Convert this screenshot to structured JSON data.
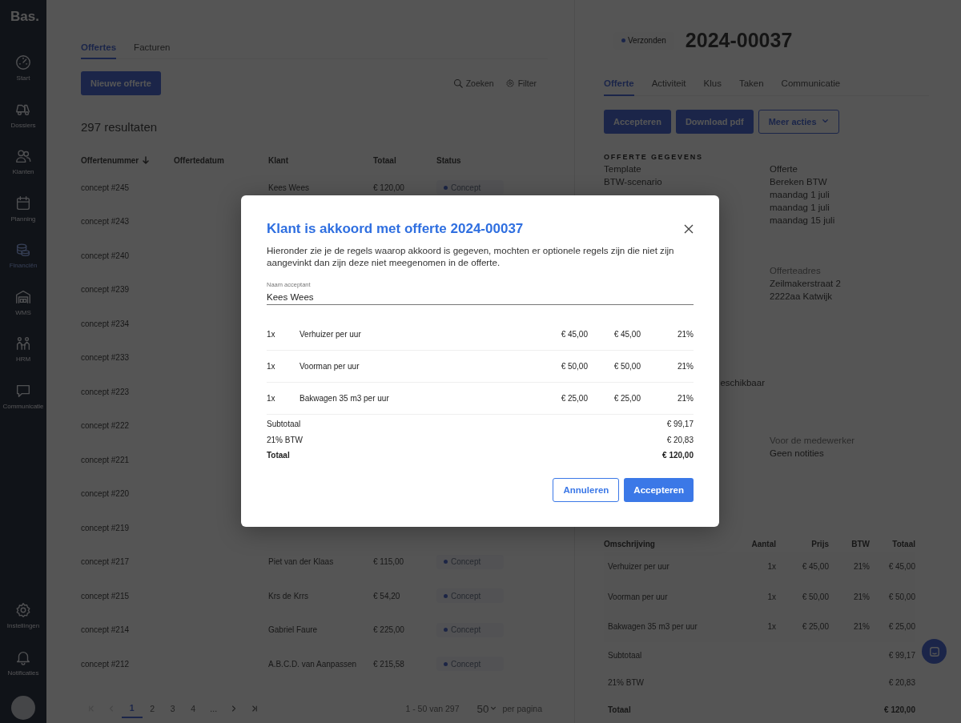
{
  "sidebar": {
    "logo": "Bas.",
    "items": [
      {
        "label": "Start",
        "selected": false
      },
      {
        "label": "Dossiers",
        "selected": false
      },
      {
        "label": "Klanten",
        "selected": false
      },
      {
        "label": "Planning",
        "selected": false
      },
      {
        "label": "Financiën",
        "selected": true
      },
      {
        "label": "WMS",
        "selected": false
      },
      {
        "label": "HRM",
        "selected": false
      },
      {
        "label": "Communicatie",
        "selected": false
      }
    ],
    "bottom_items": [
      {
        "label": "Instellingen"
      },
      {
        "label": "Notificaties"
      }
    ]
  },
  "list_panel": {
    "tabs": [
      {
        "label": "Offertes",
        "selected": true
      },
      {
        "label": "Facturen",
        "selected": false
      }
    ],
    "new_button": "Nieuwe offerte",
    "search": "Zoeken",
    "filter": "Filter",
    "result_count": "297 resultaten",
    "columns": [
      {
        "label": "Offertenummer",
        "sorted": true
      },
      {
        "label": "Offertedatum",
        "sorted": false
      },
      {
        "label": "Klant",
        "sorted": false
      },
      {
        "label": "Totaal",
        "sorted": false
      },
      {
        "label": "Status",
        "sorted": false
      }
    ],
    "rows": [
      {
        "number": "concept #245",
        "client": "Kees Wees",
        "total": "€ 120,00",
        "status": "Concept"
      },
      {
        "number": "concept #243"
      },
      {
        "number": "concept #240"
      },
      {
        "number": "concept #239"
      },
      {
        "number": "concept #234"
      },
      {
        "number": "concept #233"
      },
      {
        "number": "concept #223"
      },
      {
        "number": "concept #222"
      },
      {
        "number": "concept #221"
      },
      {
        "number": "concept #220"
      },
      {
        "number": "concept #219"
      },
      {
        "number": "concept #217",
        "client": "Piet van der Klaas",
        "total": "€ 115,00",
        "status": "Concept"
      },
      {
        "number": "concept #215",
        "client": "Krs de Krrs",
        "total": "€ 54,20",
        "status": "Concept"
      },
      {
        "number": "concept #214",
        "client": "Gabriel Faure",
        "total": "€ 225,00",
        "status": "Concept"
      },
      {
        "number": "concept #212",
        "client": "A.B.C.D. van Aanpassen",
        "total": "€ 215,58",
        "status": "Concept"
      }
    ],
    "pagination": {
      "before": [
        {
          "kind": "first",
          "disabled": true
        },
        {
          "kind": "prev",
          "disabled": true
        }
      ],
      "pages": [
        {
          "label": "1",
          "selected": true
        },
        {
          "label": "2",
          "selected": false
        },
        {
          "label": "3",
          "selected": false
        },
        {
          "label": "4",
          "selected": false
        },
        {
          "label": "...",
          "selected": false
        }
      ],
      "after": [
        {
          "kind": "next",
          "disabled": false
        },
        {
          "kind": "last",
          "disabled": false
        }
      ],
      "range": "1 - 50 van 297",
      "per_page": "50",
      "per_page_label": "per pagina"
    }
  },
  "detail_panel": {
    "status": "Verzonden",
    "number": "2024-00037",
    "tabs": [
      {
        "label": "Offerte",
        "selected": true
      },
      {
        "label": "Activiteit",
        "selected": false
      },
      {
        "label": "Klus",
        "selected": false
      },
      {
        "label": "Taken",
        "selected": false
      },
      {
        "label": "Communicatie",
        "selected": false
      }
    ],
    "actions": [
      {
        "label": "Accepteren",
        "kind": "primary"
      },
      {
        "label": "Download pdf",
        "kind": "primary"
      },
      {
        "label": "Meer acties",
        "kind": "dropdown"
      }
    ],
    "section_title": "OFFERTE GEGEVENS",
    "fields": [
      {
        "label": "Template",
        "value": "Offerte"
      },
      {
        "label": "BTW-scenario",
        "value": "Bereken BTW"
      },
      {
        "value": "maandag 1 juli"
      },
      {
        "value": "maandag 1 juli"
      },
      {
        "value": "maandag 15 juli"
      }
    ],
    "address": {
      "label": "Offerteadres",
      "lines": [
        "Zeilmakerstraat 2",
        "2222aa Katwijk"
      ]
    },
    "partial_text": "eschikbaar",
    "notes": {
      "label": "Voor de medewerker",
      "value": "Geen notities"
    },
    "columns": [
      "Omschrijving",
      "Aantal",
      "Prijs",
      "BTW",
      "Totaal"
    ],
    "lines": [
      {
        "description": "Verhuizer per uur",
        "qty": "1x",
        "price": "€ 45,00",
        "vat": "21%",
        "total": "€ 45,00"
      },
      {
        "description": "Voorman per uur",
        "qty": "1x",
        "price": "€ 50,00",
        "vat": "21%",
        "total": "€ 50,00"
      },
      {
        "description": "Bakwagen 35 m3 per uur",
        "qty": "1x",
        "price": "€ 25,00",
        "vat": "21%",
        "total": "€ 25,00"
      }
    ],
    "totals": [
      {
        "label": "Subtotaal",
        "value": "€ 99,17",
        "bold": false
      },
      {
        "label": "21% BTW",
        "value": "€ 20,83",
        "bold": false
      },
      {
        "label": "Totaal",
        "value": "€ 120,00",
        "bold": true
      }
    ]
  },
  "modal": {
    "title": "Klant is akkoord met offerte 2024-00037",
    "text": "Hieronder zie je de regels waarop akkoord is gegeven, mochten er optionele regels zijn die niet zijn aangevinkt dan zijn deze niet meegenomen in de offerte.",
    "field": {
      "label": "Naam acceptant",
      "value": "Kees Wees"
    },
    "lines": [
      {
        "qty": "1x",
        "description": "Verhuizer per uur",
        "price": "€ 45,00",
        "total": "€ 45,00",
        "vat": "21%"
      },
      {
        "qty": "1x",
        "description": "Voorman per uur",
        "price": "€ 50,00",
        "total": "€ 50,00",
        "vat": "21%"
      },
      {
        "qty": "1x",
        "description": "Bakwagen 35 m3 per uur",
        "price": "€ 25,00",
        "total": "€ 25,00",
        "vat": "21%"
      }
    ],
    "totals": [
      {
        "label": "Subtotaal",
        "value": "€ 99,17",
        "bold": false
      },
      {
        "label": "21% BTW",
        "value": "€ 20,83",
        "bold": false
      },
      {
        "label": "Totaal",
        "value": "€ 120,00",
        "bold": true
      }
    ],
    "buttons": [
      {
        "label": "Annuleren",
        "kind": "secondary"
      },
      {
        "label": "Accepteren",
        "kind": "primary"
      }
    ]
  }
}
